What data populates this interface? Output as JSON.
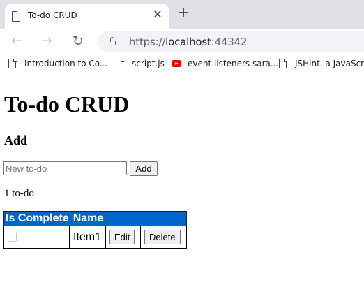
{
  "browser": {
    "tab_title": "To-do CRUD",
    "new_tab_symbol": "+",
    "close_symbol": "✕",
    "url": {
      "scheme": "https://",
      "host": "localhost",
      "port": ":44342"
    },
    "nav": {
      "back": "←",
      "forward": "→",
      "reload": "↻"
    },
    "bookmarks": [
      {
        "icon": "document-icon",
        "label": "Introduction to Co..."
      },
      {
        "icon": "document-icon",
        "label": "script.js"
      },
      {
        "icon": "youtube-icon",
        "label": "event listeners sara..."
      },
      {
        "icon": "document-icon",
        "label": "JSHint, a JavaScript"
      }
    ]
  },
  "page": {
    "title": "To-do CRUD",
    "add_heading": "Add",
    "new_todo_placeholder": "New to-do",
    "add_button": "Add",
    "counter": "1 to-do",
    "table": {
      "headers": [
        "Is Complete",
        "Name"
      ],
      "rows": [
        {
          "is_complete": false,
          "name": "Item1",
          "edit_label": "Edit",
          "delete_label": "Delete"
        }
      ]
    },
    "colors": {
      "table_header_bg": "#0066cc",
      "table_header_text": "#ffffff"
    }
  }
}
